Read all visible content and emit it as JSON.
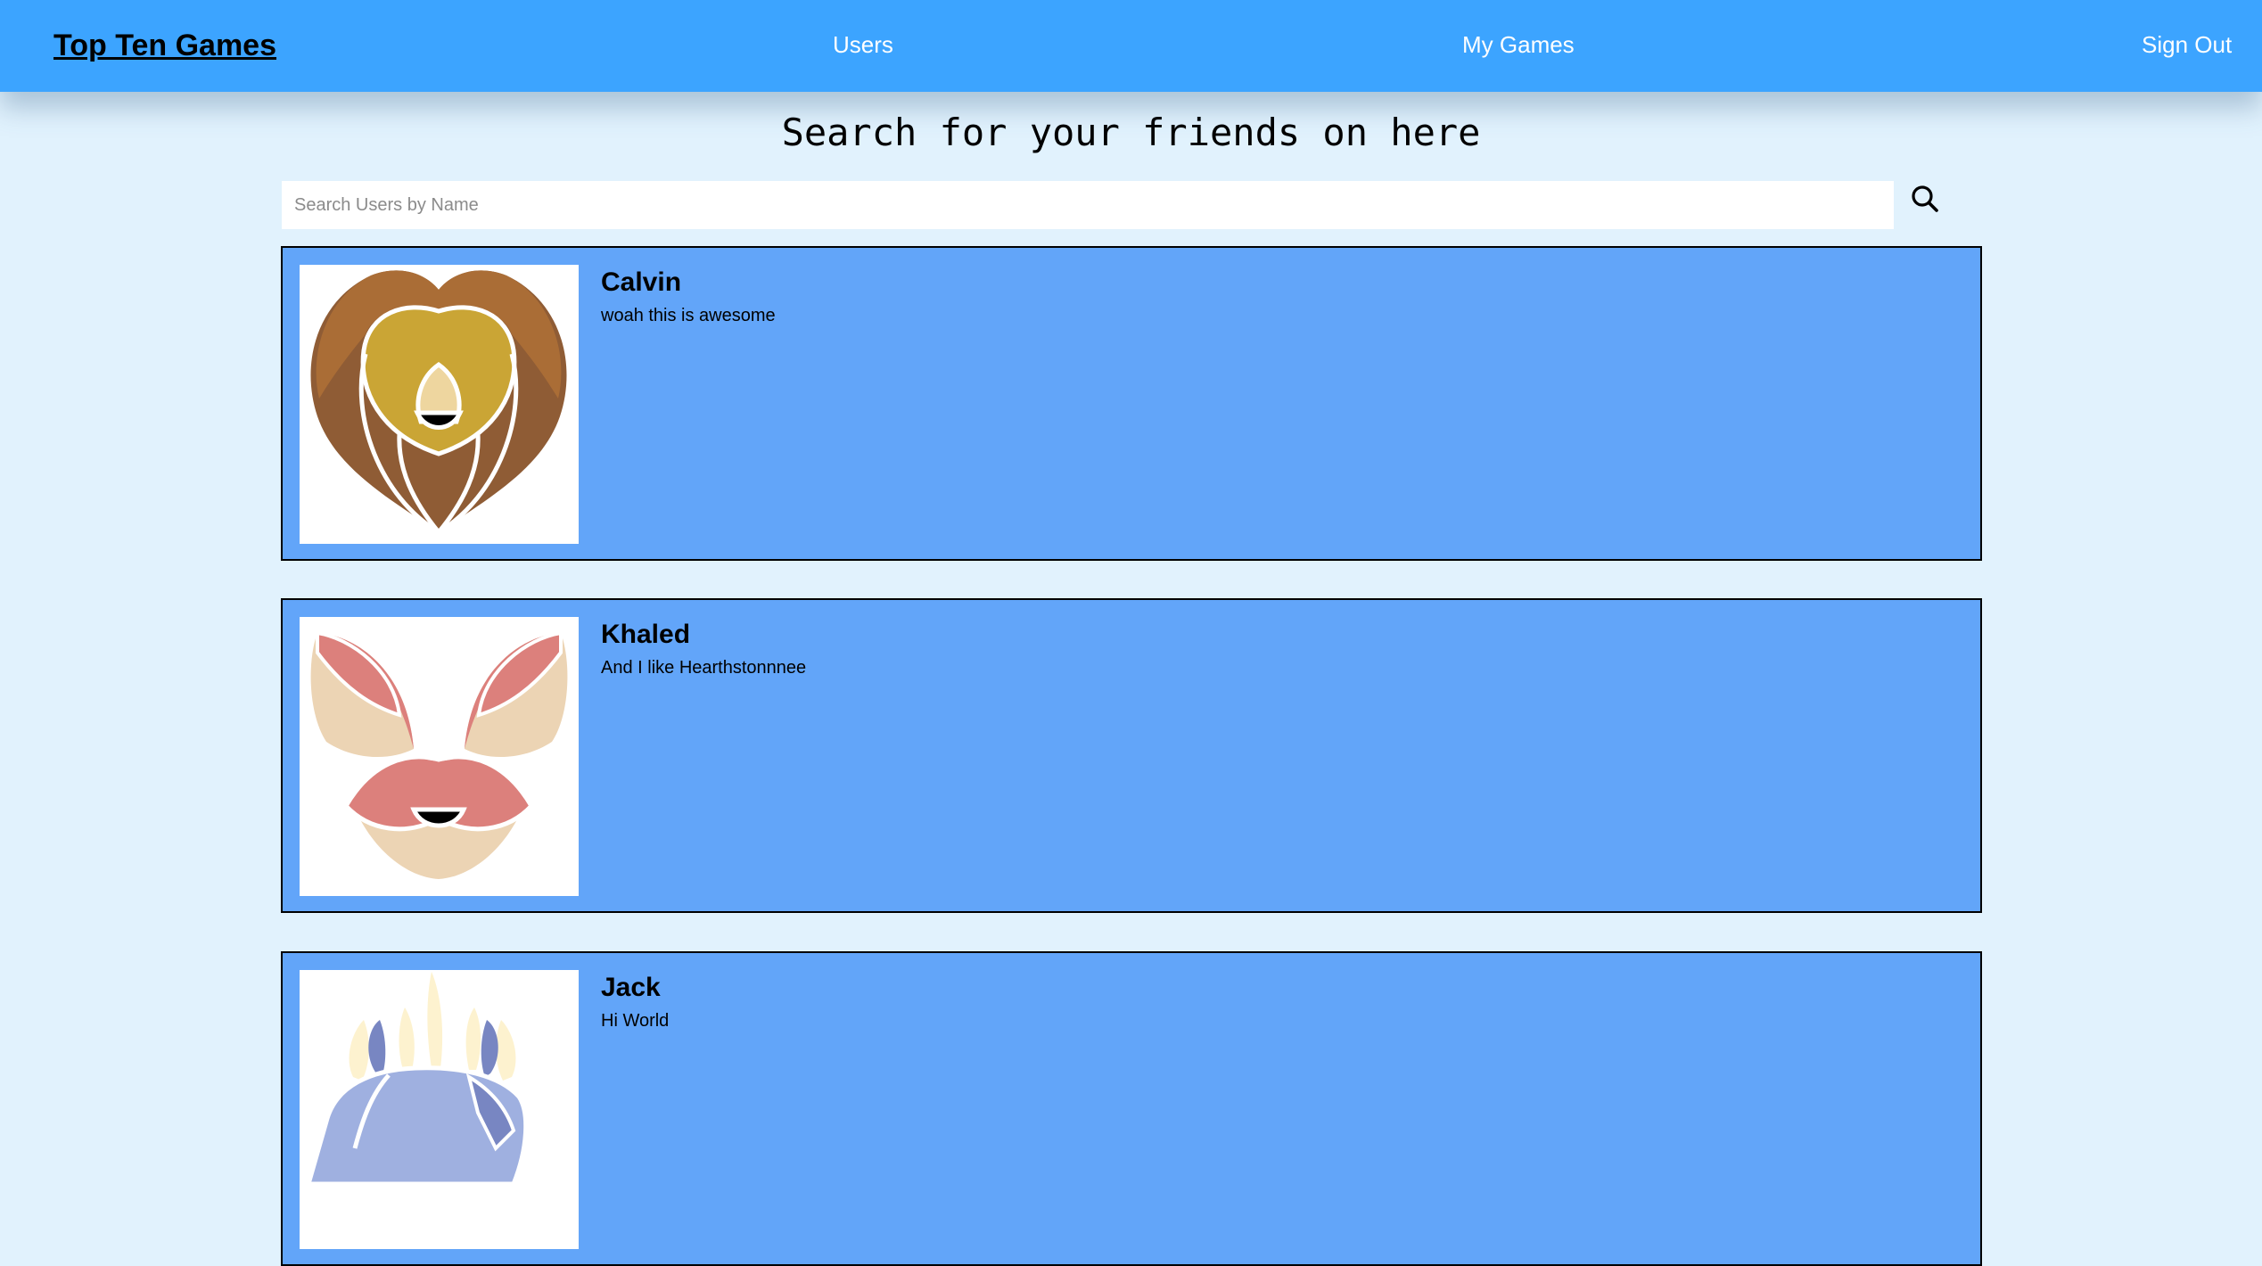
{
  "navbar": {
    "brand": "Top Ten Games",
    "links": [
      "Users",
      "My Games",
      "Sign Out"
    ]
  },
  "page": {
    "title": "Search for your friends on here"
  },
  "search": {
    "placeholder": "Search Users by Name",
    "value": "",
    "button_icon": "search-icon"
  },
  "users": [
    {
      "name": "Calvin",
      "bio": "woah this is awesome",
      "avatar_icon": "lion-avatar"
    },
    {
      "name": "Khaled",
      "bio": "And I like Hearthstonnnee",
      "avatar_icon": "rabbit-avatar"
    },
    {
      "name": "Jack",
      "bio": "Hi World",
      "avatar_icon": "unicorn-avatar"
    }
  ],
  "colors": {
    "navbar": "#3ca4ff",
    "background": "#e1f2fd",
    "card": "#62a5f9"
  }
}
